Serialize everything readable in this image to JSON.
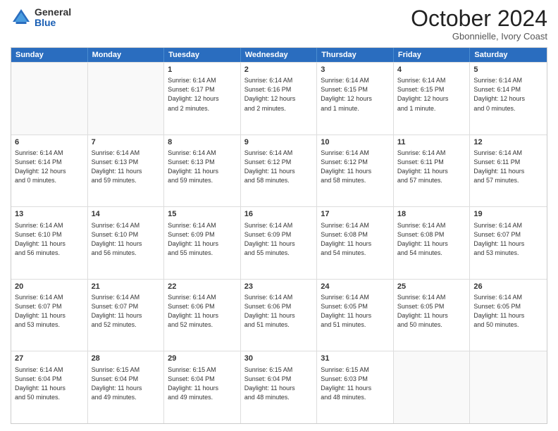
{
  "logo": {
    "general": "General",
    "blue": "Blue"
  },
  "header": {
    "month": "October 2024",
    "location": "Gbonnielle, Ivory Coast"
  },
  "weekdays": [
    "Sunday",
    "Monday",
    "Tuesday",
    "Wednesday",
    "Thursday",
    "Friday",
    "Saturday"
  ],
  "rows": [
    [
      {
        "day": "",
        "info": "",
        "empty": true
      },
      {
        "day": "",
        "info": "",
        "empty": true
      },
      {
        "day": "1",
        "info": "Sunrise: 6:14 AM\nSunset: 6:17 PM\nDaylight: 12 hours\nand 2 minutes."
      },
      {
        "day": "2",
        "info": "Sunrise: 6:14 AM\nSunset: 6:16 PM\nDaylight: 12 hours\nand 2 minutes."
      },
      {
        "day": "3",
        "info": "Sunrise: 6:14 AM\nSunset: 6:15 PM\nDaylight: 12 hours\nand 1 minute."
      },
      {
        "day": "4",
        "info": "Sunrise: 6:14 AM\nSunset: 6:15 PM\nDaylight: 12 hours\nand 1 minute."
      },
      {
        "day": "5",
        "info": "Sunrise: 6:14 AM\nSunset: 6:14 PM\nDaylight: 12 hours\nand 0 minutes."
      }
    ],
    [
      {
        "day": "6",
        "info": "Sunrise: 6:14 AM\nSunset: 6:14 PM\nDaylight: 12 hours\nand 0 minutes."
      },
      {
        "day": "7",
        "info": "Sunrise: 6:14 AM\nSunset: 6:13 PM\nDaylight: 11 hours\nand 59 minutes."
      },
      {
        "day": "8",
        "info": "Sunrise: 6:14 AM\nSunset: 6:13 PM\nDaylight: 11 hours\nand 59 minutes."
      },
      {
        "day": "9",
        "info": "Sunrise: 6:14 AM\nSunset: 6:12 PM\nDaylight: 11 hours\nand 58 minutes."
      },
      {
        "day": "10",
        "info": "Sunrise: 6:14 AM\nSunset: 6:12 PM\nDaylight: 11 hours\nand 58 minutes."
      },
      {
        "day": "11",
        "info": "Sunrise: 6:14 AM\nSunset: 6:11 PM\nDaylight: 11 hours\nand 57 minutes."
      },
      {
        "day": "12",
        "info": "Sunrise: 6:14 AM\nSunset: 6:11 PM\nDaylight: 11 hours\nand 57 minutes."
      }
    ],
    [
      {
        "day": "13",
        "info": "Sunrise: 6:14 AM\nSunset: 6:10 PM\nDaylight: 11 hours\nand 56 minutes."
      },
      {
        "day": "14",
        "info": "Sunrise: 6:14 AM\nSunset: 6:10 PM\nDaylight: 11 hours\nand 56 minutes."
      },
      {
        "day": "15",
        "info": "Sunrise: 6:14 AM\nSunset: 6:09 PM\nDaylight: 11 hours\nand 55 minutes."
      },
      {
        "day": "16",
        "info": "Sunrise: 6:14 AM\nSunset: 6:09 PM\nDaylight: 11 hours\nand 55 minutes."
      },
      {
        "day": "17",
        "info": "Sunrise: 6:14 AM\nSunset: 6:08 PM\nDaylight: 11 hours\nand 54 minutes."
      },
      {
        "day": "18",
        "info": "Sunrise: 6:14 AM\nSunset: 6:08 PM\nDaylight: 11 hours\nand 54 minutes."
      },
      {
        "day": "19",
        "info": "Sunrise: 6:14 AM\nSunset: 6:07 PM\nDaylight: 11 hours\nand 53 minutes."
      }
    ],
    [
      {
        "day": "20",
        "info": "Sunrise: 6:14 AM\nSunset: 6:07 PM\nDaylight: 11 hours\nand 53 minutes."
      },
      {
        "day": "21",
        "info": "Sunrise: 6:14 AM\nSunset: 6:07 PM\nDaylight: 11 hours\nand 52 minutes."
      },
      {
        "day": "22",
        "info": "Sunrise: 6:14 AM\nSunset: 6:06 PM\nDaylight: 11 hours\nand 52 minutes."
      },
      {
        "day": "23",
        "info": "Sunrise: 6:14 AM\nSunset: 6:06 PM\nDaylight: 11 hours\nand 51 minutes."
      },
      {
        "day": "24",
        "info": "Sunrise: 6:14 AM\nSunset: 6:05 PM\nDaylight: 11 hours\nand 51 minutes."
      },
      {
        "day": "25",
        "info": "Sunrise: 6:14 AM\nSunset: 6:05 PM\nDaylight: 11 hours\nand 50 minutes."
      },
      {
        "day": "26",
        "info": "Sunrise: 6:14 AM\nSunset: 6:05 PM\nDaylight: 11 hours\nand 50 minutes."
      }
    ],
    [
      {
        "day": "27",
        "info": "Sunrise: 6:14 AM\nSunset: 6:04 PM\nDaylight: 11 hours\nand 50 minutes."
      },
      {
        "day": "28",
        "info": "Sunrise: 6:15 AM\nSunset: 6:04 PM\nDaylight: 11 hours\nand 49 minutes."
      },
      {
        "day": "29",
        "info": "Sunrise: 6:15 AM\nSunset: 6:04 PM\nDaylight: 11 hours\nand 49 minutes."
      },
      {
        "day": "30",
        "info": "Sunrise: 6:15 AM\nSunset: 6:04 PM\nDaylight: 11 hours\nand 48 minutes."
      },
      {
        "day": "31",
        "info": "Sunrise: 6:15 AM\nSunset: 6:03 PM\nDaylight: 11 hours\nand 48 minutes."
      },
      {
        "day": "",
        "info": "",
        "empty": true
      },
      {
        "day": "",
        "info": "",
        "empty": true
      }
    ]
  ]
}
